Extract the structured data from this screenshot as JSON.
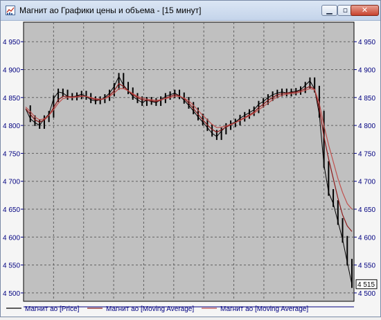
{
  "window": {
    "title": "Магнит ао Графики цены и объема - [15 минут]",
    "icons": [
      "chart-app-icon",
      "minimize-icon",
      "restore-icon",
      "close-icon"
    ],
    "minimize_glyph": "▁",
    "restore_glyph": "▫",
    "close_glyph": "✕"
  },
  "chart_data": {
    "type": "line",
    "title": "",
    "y_ticks": [
      "4 950",
      "4 900",
      "4 850",
      "4 800",
      "4 750",
      "4 700",
      "4 650",
      "4 600",
      "4 550",
      "4 500"
    ],
    "ylim": [
      4485,
      4985
    ],
    "xlim": [
      0,
      300
    ],
    "grid": true,
    "background_color": "#c0c0c0",
    "last_value_label": "4 515",
    "series": [
      {
        "name": "Магнит ао [Price]",
        "color": "#000000",
        "values": [
          4830,
          4812,
          4805,
          4800,
          4812,
          4820,
          4848,
          4860,
          4858,
          4852,
          4851,
          4853,
          4856,
          4852,
          4846,
          4844,
          4846,
          4850,
          4858,
          4870,
          4888,
          4872,
          4862,
          4852,
          4846,
          4841,
          4845,
          4843,
          4841,
          4846,
          4852,
          4855,
          4858,
          4853,
          4845,
          4836,
          4826,
          4815,
          4806,
          4796,
          4786,
          4780,
          4790,
          4798,
          4803,
          4806,
          4813,
          4818,
          4823,
          4828,
          4838,
          4843,
          4850,
          4855,
          4858,
          4860,
          4858,
          4860,
          4861,
          4864,
          4872,
          4880,
          4865,
          4820,
          4730,
          4680,
          4660,
          4628,
          4596,
          4555,
          4515
        ]
      },
      {
        "name": "Магнит ао [Moving Average]",
        "color": "#8b1a1a",
        "values": [
          4830,
          4820,
          4810,
          4806,
          4810,
          4818,
          4832,
          4846,
          4852,
          4852,
          4851,
          4852,
          4853,
          4852,
          4849,
          4846,
          4846,
          4848,
          4854,
          4862,
          4875,
          4870,
          4862,
          4855,
          4850,
          4846,
          4845,
          4844,
          4843,
          4845,
          4849,
          4852,
          4855,
          4853,
          4848,
          4840,
          4830,
          4820,
          4810,
          4801,
          4793,
          4788,
          4792,
          4797,
          4801,
          4805,
          4810,
          4814,
          4819,
          4824,
          4832,
          4838,
          4845,
          4850,
          4855,
          4857,
          4858,
          4859,
          4860,
          4862,
          4866,
          4870,
          4865,
          4830,
          4780,
          4740,
          4705,
          4670,
          4640,
          4620,
          4610
        ]
      },
      {
        "name": "Магнит ао [Moving Average]",
        "color": "#c0504d",
        "values": [
          4833,
          4825,
          4815,
          4810,
          4812,
          4818,
          4828,
          4840,
          4848,
          4850,
          4850,
          4851,
          4852,
          4852,
          4850,
          4848,
          4847,
          4848,
          4852,
          4858,
          4866,
          4866,
          4862,
          4857,
          4852,
          4849,
          4847,
          4846,
          4845,
          4846,
          4848,
          4850,
          4852,
          4852,
          4849,
          4844,
          4836,
          4827,
          4818,
          4810,
          4802,
          4796,
          4797,
          4799,
          4802,
          4805,
          4809,
          4813,
          4817,
          4822,
          4828,
          4834,
          4840,
          4846,
          4851,
          4854,
          4856,
          4857,
          4858,
          4860,
          4863,
          4866,
          4864,
          4840,
          4800,
          4765,
          4735,
          4705,
          4680,
          4660,
          4650
        ]
      }
    ],
    "legend": [
      "Магнит ао [Price]",
      "Магнит ао [Moving Average]",
      "Магнит ао [Moving Average]"
    ],
    "legend_position": "bottom"
  }
}
